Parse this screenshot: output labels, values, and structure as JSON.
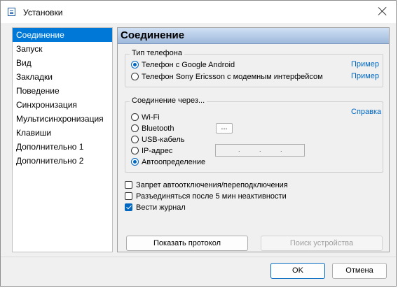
{
  "window": {
    "title": "Установки"
  },
  "sidebar": {
    "items": [
      {
        "label": "Соединение",
        "selected": true
      },
      {
        "label": "Запуск"
      },
      {
        "label": "Вид"
      },
      {
        "label": "Закладки"
      },
      {
        "label": "Поведение"
      },
      {
        "label": "Синхронизация"
      },
      {
        "label": "Мультисинхронизация"
      },
      {
        "label": "Клавиши"
      },
      {
        "label": "Дополнительно 1"
      },
      {
        "label": "Дополнительно 2"
      }
    ]
  },
  "panel": {
    "title": "Соединение",
    "phone_type": {
      "title": "Тип телефона",
      "options": [
        {
          "label": "Телефон с Google Android",
          "selected": true,
          "link": "Пример"
        },
        {
          "label": "Телефон Sony Ericsson с модемным интерфейсом",
          "selected": false,
          "link": "Пример"
        }
      ]
    },
    "connection": {
      "title": "Соединение через...",
      "help_link": "Справка",
      "options": [
        {
          "label": "Wi-Fi",
          "selected": false
        },
        {
          "label": "Bluetooth",
          "selected": false
        },
        {
          "label": "USB-кабель",
          "selected": false
        },
        {
          "label": "IP-адрес",
          "selected": false
        },
        {
          "label": "Автоопределение",
          "selected": true
        }
      ],
      "bluetooth_button": "...",
      "ip_dots": [
        ".",
        ".",
        "."
      ]
    },
    "checks": [
      {
        "label": "Запрет автоотключения/переподключения",
        "checked": false
      },
      {
        "label": "Разъединяться после 5 мин неактивности",
        "checked": false
      },
      {
        "label": "Вести журнал",
        "checked": true
      }
    ],
    "show_log_button": "Показать протокол",
    "find_device_button": "Поиск устройства"
  },
  "footer": {
    "ok": "OK",
    "cancel": "Отмена"
  },
  "colors": {
    "accent": "#0067c0",
    "selection": "#0078d7"
  }
}
